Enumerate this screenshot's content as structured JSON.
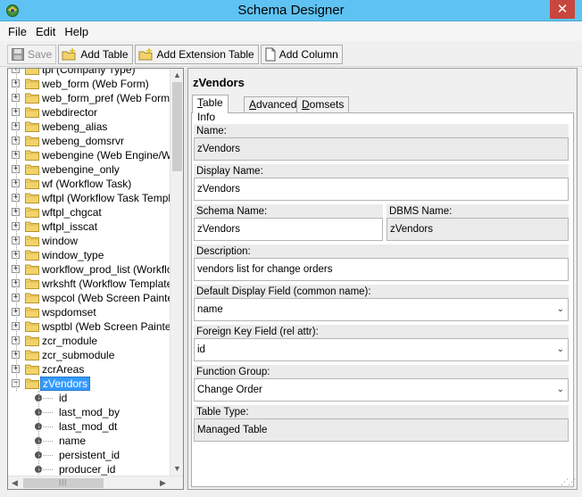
{
  "window": {
    "title": "Schema Designer",
    "close_glyph": "✕"
  },
  "menu": [
    "File",
    "Edit",
    "Help"
  ],
  "toolbar": {
    "save": "Save",
    "add_table": "Add Table",
    "add_extension_table": "Add Extension Table",
    "add_column": "Add Column"
  },
  "tree": {
    "partial_top": "tpl (Company Type)",
    "items": [
      "web_form (Web Form)",
      "web_form_pref (Web Form Pr",
      "webdirector",
      "webeng_alias",
      "webeng_domsrvr",
      "webengine (Web Engine/Web",
      "webengine_only",
      "wf (Workflow Task)",
      "wftpl (Workflow Task Templat",
      "wftpl_chgcat",
      "wftpl_isscat",
      "window",
      "window_type",
      "workflow_prod_list (Workflow",
      "wrkshft (Workflow Template V",
      "wspcol (Web Screen Painter C",
      "wspdomset",
      "wsptbl (Web Screen Painter T",
      "zcr_module",
      "zcr_submodule",
      "zcrAreas"
    ],
    "selected": "zVendors",
    "expand_glyph": "+",
    "collapse_glyph": "−",
    "children": [
      "id",
      "last_mod_by",
      "last_mod_dt",
      "name",
      "persistent_id",
      "producer_id"
    ]
  },
  "detail": {
    "title": "zVendors",
    "tabs": [
      {
        "u": "T",
        "rest": "able Info"
      },
      {
        "u": "A",
        "rest": "dvanced"
      },
      {
        "u": "D",
        "rest": "omsets"
      }
    ],
    "fields": {
      "name_label": "Name:",
      "name_value": "zVendors",
      "display_name_label": "Display Name:",
      "display_name_value": "zVendors",
      "schema_name_label": "Schema Name:",
      "schema_name_value": "zVendors",
      "dbms_name_label": "DBMS Name:",
      "dbms_name_value": "zVendors",
      "description_label": "Description:",
      "description_value": "vendors list for change orders",
      "default_display_label": "Default Display Field (common name):",
      "default_display_value": "name",
      "foreign_key_label": "Foreign Key Field (rel attr):",
      "foreign_key_value": "id",
      "function_group_label": "Function Group:",
      "function_group_value": "Change Order",
      "table_type_label": "Table Type:",
      "table_type_value": "Managed Table"
    },
    "dropdown_glyph": "⌄"
  },
  "icons": {
    "app": "schema-designer-icon",
    "save": "floppy-disk-icon",
    "add_table": "folder-sparkle-icon",
    "add_extension_table": "folder-sparkle-icon",
    "add_column": "page-icon",
    "folder": "folder-icon",
    "column": "column-dot-icon"
  },
  "colors": {
    "titlebar": "#5ec3f2",
    "selection": "#3399ff",
    "close": "#c7463d"
  }
}
